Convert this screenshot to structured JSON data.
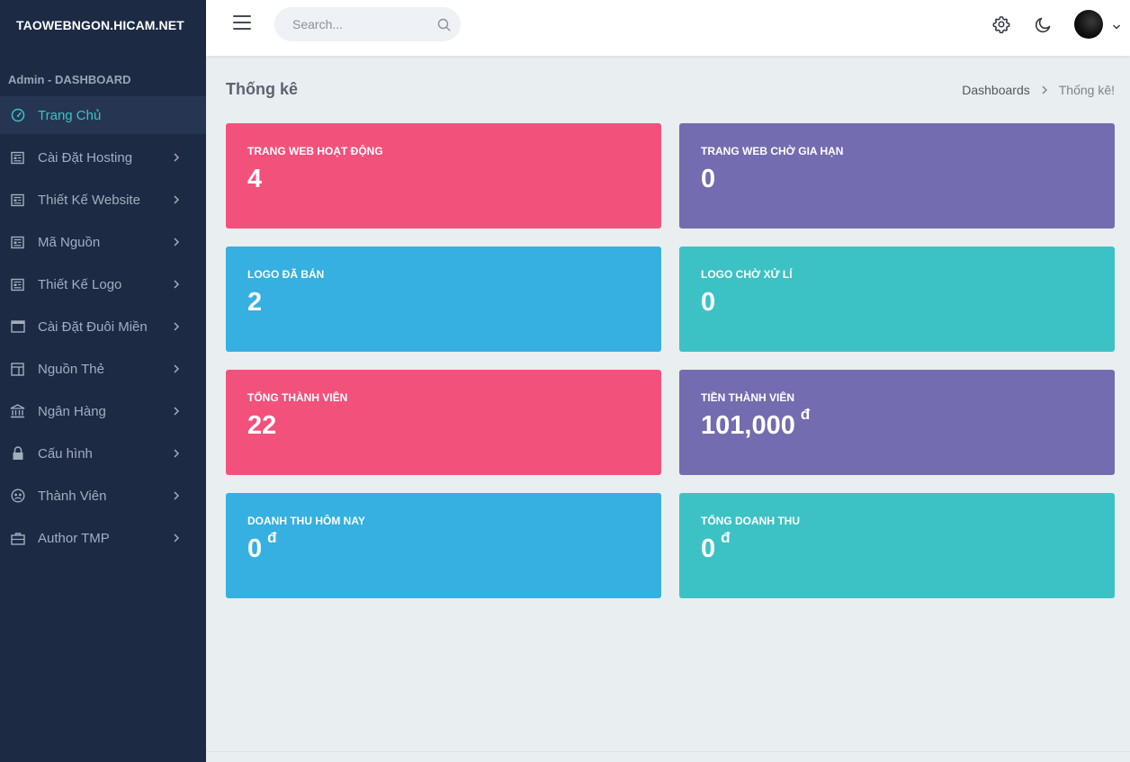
{
  "brand": "TAOWEBNGON.HICAM.NET",
  "sidebar": {
    "menu_title": "Admin - DASHBOARD",
    "items": [
      {
        "label": "Trang Chủ",
        "icon": "dashboard-gauge-icon"
      },
      {
        "label": "Cài Đặt Hosting",
        "icon": "newspaper-icon"
      },
      {
        "label": "Thiết Kế Website",
        "icon": "newspaper-icon"
      },
      {
        "label": "Mã Nguồn",
        "icon": "newspaper-icon"
      },
      {
        "label": "Thiết Kế Logo",
        "icon": "newspaper-icon"
      },
      {
        "label": "Cài Đặt Đuôi Miền",
        "icon": "browser-window-icon"
      },
      {
        "label": "Nguồn Thẻ",
        "icon": "layout-icon"
      },
      {
        "label": "Ngân Hàng",
        "icon": "bank-icon"
      },
      {
        "label": "Cấu hình",
        "icon": "lock-icon"
      },
      {
        "label": "Thành Viên",
        "icon": "users-icon"
      },
      {
        "label": "Author TMP",
        "icon": "briefcase-icon"
      }
    ]
  },
  "search": {
    "placeholder": "Search..."
  },
  "page": {
    "title": "Thống kê",
    "breadcrumb": {
      "link": "Dashboards",
      "current": "Thống kê!"
    }
  },
  "stats": [
    {
      "label": "TRANG WEB HOẠT ĐỘNG",
      "value": "4",
      "unit": "",
      "color": "#f2517b"
    },
    {
      "label": "TRANG WEB CHỜ GIA HẠN",
      "value": "0",
      "unit": "",
      "color": "#736cb0"
    },
    {
      "label": "LOGO ĐÃ BÁN",
      "value": "2",
      "unit": "",
      "color": "#35b0e0"
    },
    {
      "label": "LOGO CHỜ XỬ LÍ",
      "value": "0",
      "unit": "",
      "color": "#3cc2c4"
    },
    {
      "label": "TỔNG THÀNH VIÊN",
      "value": "22",
      "unit": "",
      "color": "#f2517b"
    },
    {
      "label": "TIỀN THÀNH VIÊN",
      "value": "101,000",
      "unit": "đ",
      "color": "#736cb0"
    },
    {
      "label": "DOANH THU HÔM NAY",
      "value": "0",
      "unit": "đ",
      "color": "#35b0e0"
    },
    {
      "label": "TỔNG DOANH THU",
      "value": "0",
      "unit": "đ",
      "color": "#3cc2c4"
    }
  ],
  "colors": {
    "sidebar_bg": "#1c2a44",
    "active_accent": "#3dc2c4",
    "content_bg": "#e9eef0"
  }
}
